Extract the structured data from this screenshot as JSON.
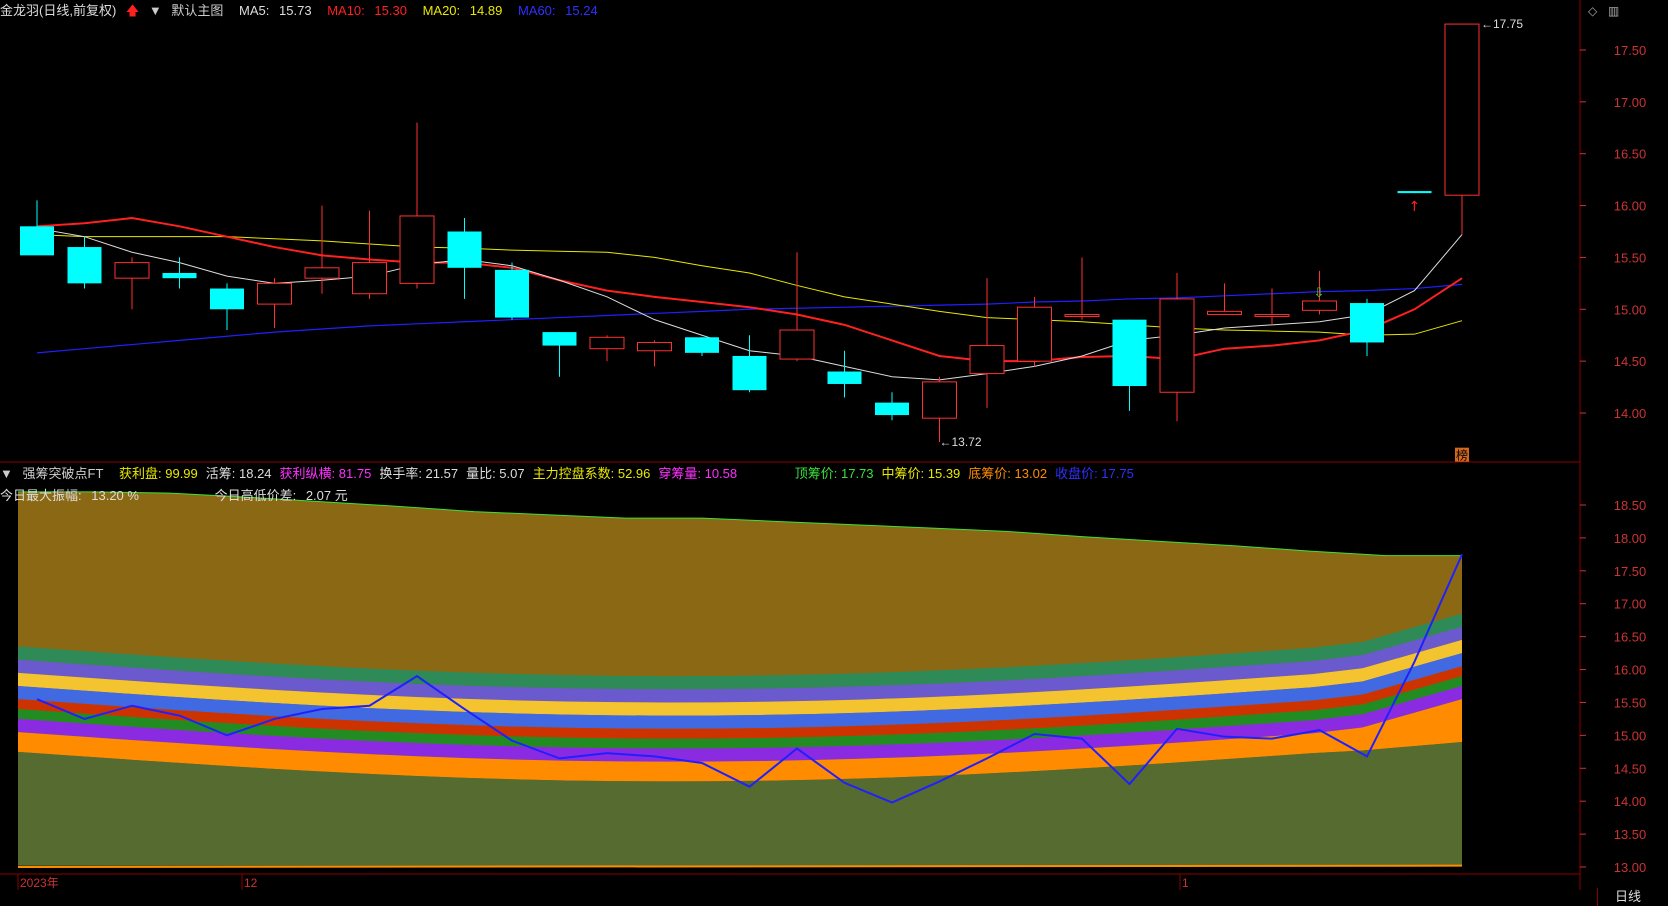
{
  "top": {
    "stock": "金龙羽(日线,前复权)",
    "main_chart": "默认主图",
    "ma5": {
      "label": "MA5:",
      "value": "15.73",
      "color": "#dddddd"
    },
    "ma10": {
      "label": "MA10:",
      "value": "15.30",
      "color": "#ff2020"
    },
    "ma20": {
      "label": "MA20:",
      "value": "14.89",
      "color": "#e8e800"
    },
    "ma60": {
      "label": "MA60:",
      "value": "15.24",
      "color": "#2020ff"
    },
    "max_label": "17.75",
    "min_label": "13.72",
    "badge": "榜"
  },
  "bottom": {
    "indicator": "强筹突破点FT",
    "items": [
      {
        "label": "获利盘:",
        "value": "99.99",
        "color": "#e8e800"
      },
      {
        "label": "活筹:",
        "value": "18.24",
        "color": "#dddddd"
      },
      {
        "label": "获利纵横:",
        "value": "81.75",
        "color": "#ff30ff"
      },
      {
        "label": "换手率:",
        "value": "21.57",
        "color": "#dddddd"
      },
      {
        "label": "量比:",
        "value": "5.07",
        "color": "#dddddd"
      },
      {
        "label": "主力控盘系数:",
        "value": "52.96",
        "color": "#e8e800"
      },
      {
        "label": "穿筹量:",
        "value": "10.58",
        "color": "#ff30ff"
      }
    ],
    "prices": [
      {
        "label": "顶筹价:",
        "value": "17.73",
        "color": "#3ce03c"
      },
      {
        "label": "中筹价:",
        "value": "15.39",
        "color": "#e8e800"
      },
      {
        "label": "底筹价:",
        "value": "13.02",
        "color": "#ff8c00"
      },
      {
        "label": "收盘价:",
        "value": "17.75",
        "color": "#3030ff"
      }
    ],
    "amp_label": "今日最大振幅:",
    "amp_value": "13.20 %",
    "diff_label": "今日高低价差:",
    "diff_value": "2.07 元"
  },
  "top_axis": [
    "17.50",
    "17.00",
    "16.50",
    "16.00",
    "15.50",
    "15.00",
    "14.50",
    "14.00"
  ],
  "bottom_axis": [
    "18.50",
    "18.00",
    "17.50",
    "17.00",
    "16.50",
    "16.00",
    "15.50",
    "15.00",
    "14.50",
    "14.00",
    "13.50",
    "13.00"
  ],
  "dates": [
    "2023年",
    "12",
    "1"
  ],
  "period": "日线",
  "candles": [
    {
      "o": 15.8,
      "h": 16.05,
      "l": 15.55,
      "c": 15.52
    },
    {
      "o": 15.6,
      "h": 15.7,
      "l": 15.2,
      "c": 15.25
    },
    {
      "o": 15.3,
      "h": 15.5,
      "l": 15.0,
      "c": 15.45
    },
    {
      "o": 15.35,
      "h": 15.5,
      "l": 15.2,
      "c": 15.3
    },
    {
      "o": 15.2,
      "h": 15.25,
      "l": 14.8,
      "c": 15.0
    },
    {
      "o": 15.05,
      "h": 15.3,
      "l": 14.82,
      "c": 15.25
    },
    {
      "o": 15.3,
      "h": 16.0,
      "l": 15.15,
      "c": 15.4
    },
    {
      "o": 15.15,
      "h": 15.95,
      "l": 15.1,
      "c": 15.45
    },
    {
      "o": 15.25,
      "h": 16.8,
      "l": 15.2,
      "c": 15.9
    },
    {
      "o": 15.75,
      "h": 15.88,
      "l": 15.1,
      "c": 15.4
    },
    {
      "o": 15.38,
      "h": 15.45,
      "l": 14.9,
      "c": 14.92
    },
    {
      "o": 14.78,
      "h": 14.78,
      "l": 14.35,
      "c": 14.65
    },
    {
      "o": 14.62,
      "h": 14.75,
      "l": 14.5,
      "c": 14.73
    },
    {
      "o": 14.6,
      "h": 14.7,
      "l": 14.45,
      "c": 14.68
    },
    {
      "o": 14.73,
      "h": 14.73,
      "l": 14.55,
      "c": 14.58
    },
    {
      "o": 14.55,
      "h": 14.75,
      "l": 14.2,
      "c": 14.22
    },
    {
      "o": 14.52,
      "h": 15.55,
      "l": 14.5,
      "c": 14.8
    },
    {
      "o": 14.4,
      "h": 14.6,
      "l": 14.15,
      "c": 14.28
    },
    {
      "o": 14.1,
      "h": 14.2,
      "l": 13.93,
      "c": 13.98
    },
    {
      "o": 13.95,
      "h": 14.35,
      "l": 13.72,
      "c": 14.3
    },
    {
      "o": 14.38,
      "h": 15.3,
      "l": 14.05,
      "c": 14.65
    },
    {
      "o": 14.5,
      "h": 15.12,
      "l": 14.45,
      "c": 15.02
    },
    {
      "o": 14.93,
      "h": 15.5,
      "l": 14.9,
      "c": 14.95
    },
    {
      "o": 14.9,
      "h": 14.9,
      "l": 14.02,
      "c": 14.26
    },
    {
      "o": 14.2,
      "h": 15.35,
      "l": 13.92,
      "c": 15.1
    },
    {
      "o": 14.95,
      "h": 15.25,
      "l": 14.95,
      "c": 14.98
    },
    {
      "o": 14.95,
      "h": 15.2,
      "l": 14.85,
      "c": 14.95
    },
    {
      "o": 14.99,
      "h": 15.37,
      "l": 14.95,
      "c": 15.08
    },
    {
      "o": 15.06,
      "h": 15.1,
      "l": 14.55,
      "c": 14.68
    },
    {
      "o": 16.14,
      "h": 16.14,
      "l": 16.12,
      "c": 16.12
    },
    {
      "o": 16.1,
      "h": 17.75,
      "l": 15.72,
      "c": 17.75
    }
  ],
  "ma5_series": [
    15.78,
    15.7,
    15.55,
    15.45,
    15.32,
    15.25,
    15.28,
    15.32,
    15.43,
    15.48,
    15.42,
    15.28,
    15.12,
    14.9,
    14.75,
    14.6,
    14.55,
    14.45,
    14.35,
    14.32,
    14.38,
    14.45,
    14.55,
    14.7,
    14.75,
    14.82,
    14.85,
    14.88,
    14.95,
    15.18,
    15.72
  ],
  "ma10_series": [
    15.8,
    15.83,
    15.88,
    15.8,
    15.7,
    15.6,
    15.52,
    15.48,
    15.45,
    15.45,
    15.4,
    15.28,
    15.18,
    15.12,
    15.07,
    15.02,
    14.95,
    14.85,
    14.7,
    14.55,
    14.5,
    14.5,
    14.54,
    14.55,
    14.52,
    14.62,
    14.65,
    14.7,
    14.8,
    15.0,
    15.3
  ],
  "ma20_series": [
    15.72,
    15.7,
    15.7,
    15.7,
    15.7,
    15.68,
    15.66,
    15.63,
    15.6,
    15.59,
    15.57,
    15.56,
    15.55,
    15.5,
    15.42,
    15.35,
    15.23,
    15.12,
    15.05,
    14.98,
    14.92,
    14.9,
    14.88,
    14.85,
    14.82,
    14.8,
    14.79,
    14.78,
    14.75,
    14.76,
    14.89
  ],
  "ma60_series": [
    14.58,
    14.62,
    14.66,
    14.7,
    14.74,
    14.78,
    14.81,
    14.84,
    14.86,
    14.88,
    14.9,
    14.92,
    14.94,
    14.96,
    14.98,
    15.0,
    15.01,
    15.02,
    15.03,
    15.04,
    15.05,
    15.07,
    15.08,
    15.1,
    15.11,
    15.13,
    15.15,
    15.17,
    15.18,
    15.2,
    15.24
  ],
  "close_series": [
    15.55,
    15.25,
    15.45,
    15.3,
    15.0,
    15.25,
    15.4,
    15.45,
    15.9,
    15.4,
    14.92,
    14.65,
    14.73,
    14.68,
    14.58,
    14.22,
    14.8,
    14.28,
    13.98,
    14.3,
    14.65,
    15.02,
    14.95,
    14.26,
    15.1,
    14.98,
    14.95,
    15.08,
    14.68,
    16.12,
    17.75
  ],
  "chip_top_series": [
    18.7,
    18.7,
    18.68,
    18.62,
    18.55,
    18.48,
    18.4,
    18.35,
    18.3,
    18.3,
    18.25,
    18.2,
    18.15,
    18.1,
    18.02,
    17.95,
    17.88,
    17.8,
    17.73,
    17.73
  ]
}
